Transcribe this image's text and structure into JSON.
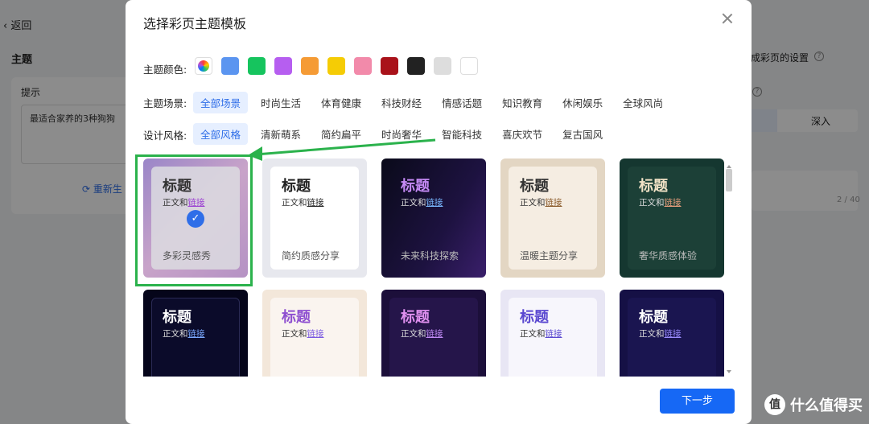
{
  "background": {
    "back_label": "返回",
    "section_title": "主题",
    "tip_label": "提示",
    "textarea_value": "最适合家养的3种狗狗",
    "regenerate_label": "重新生",
    "right_label": "成彩页的设置",
    "segment_label": "深入",
    "char_count": "2 / 40"
  },
  "modal": {
    "title": "选择彩页主题模板",
    "color_label": "主题颜色:",
    "colors": [
      "#5b95f0",
      "#16c45e",
      "#b65ef0",
      "#f59b35",
      "#f5cc05",
      "#f28aaa",
      "#a9121a",
      "#222222",
      "#dddddd",
      "#ffffff"
    ],
    "scene_label": "主题场景:",
    "scenes": [
      "全部场景",
      "时尚生活",
      "体育健康",
      "科技财经",
      "情感话题",
      "知识教育",
      "休闲娱乐",
      "全球风尚"
    ],
    "style_label": "设计风格:",
    "styles": [
      "全部风格",
      "清新萌系",
      "简约扁平",
      "时尚奢华",
      "智能科技",
      "喜庆欢节",
      "复古国风"
    ],
    "next_label": "下一步"
  },
  "cards": [
    {
      "title": "标题",
      "body": "正文和",
      "link": "链接",
      "name": "多彩灵感秀",
      "selected": true
    },
    {
      "title": "标题",
      "body": "正文和",
      "link": "链接",
      "name": "简约质感分享"
    },
    {
      "title": "标题",
      "body": "正文和",
      "link": "链接",
      "name": "未来科技探索"
    },
    {
      "title": "标题",
      "body": "正文和",
      "link": "链接",
      "name": "温暖主题分享"
    },
    {
      "title": "标题",
      "body": "正文和",
      "link": "链接",
      "name": "奢华质感体验"
    },
    {
      "title": "标题",
      "body": "正文和",
      "link": "链接"
    },
    {
      "title": "标题",
      "body": "正文和",
      "link": "链接"
    },
    {
      "title": "标题",
      "body": "正文和",
      "link": "链接"
    },
    {
      "title": "标题",
      "body": "正文和",
      "link": "链接"
    },
    {
      "title": "标题",
      "body": "正文和",
      "link": "链接"
    }
  ],
  "watermark": {
    "text": "什么值得买",
    "icon": "值"
  }
}
